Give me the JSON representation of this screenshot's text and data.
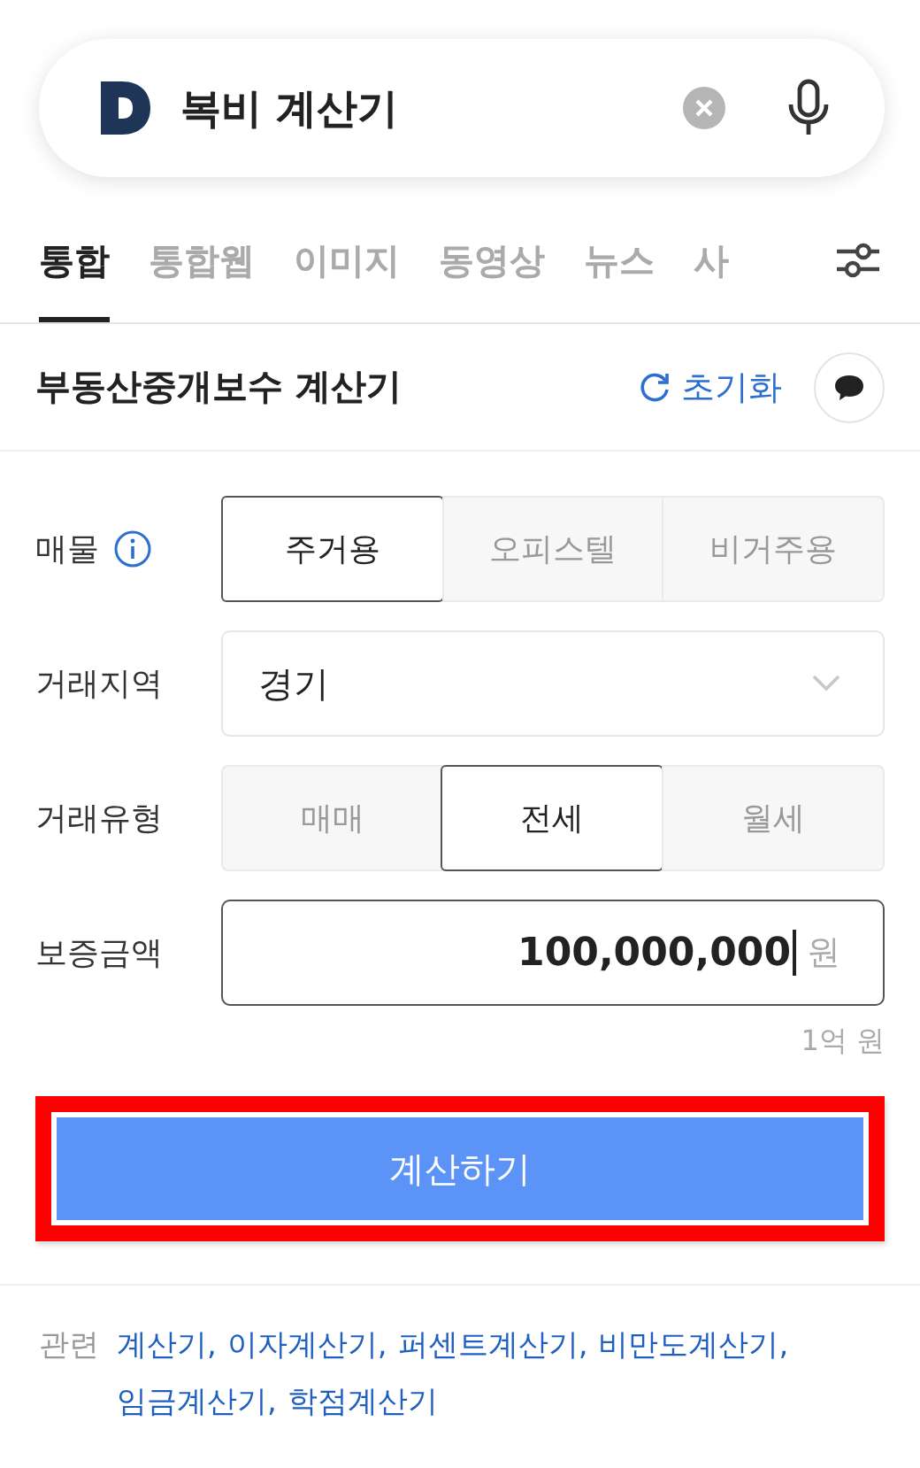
{
  "search": {
    "value": "복비 계산기"
  },
  "tabs": [
    {
      "label": "통합",
      "selected": true
    },
    {
      "label": "통합웹",
      "selected": false
    },
    {
      "label": "이미지",
      "selected": false
    },
    {
      "label": "동영상",
      "selected": false
    },
    {
      "label": "뉴스",
      "selected": false
    },
    {
      "label": "사",
      "selected": false
    }
  ],
  "calculator": {
    "title": "부동산중개보수 계산기",
    "reset": "초기화",
    "fields": [
      {
        "kind": "segments",
        "label": "매물",
        "info": true,
        "options": [
          {
            "label": "주거용",
            "selected": true
          },
          {
            "label": "오피스텔",
            "selected": false
          },
          {
            "label": "비거주용",
            "selected": false
          }
        ]
      },
      {
        "kind": "select",
        "label": "거래지역",
        "value": "경기"
      },
      {
        "kind": "segments",
        "label": "거래유형",
        "info": false,
        "options": [
          {
            "label": "매매",
            "selected": false
          },
          {
            "label": "전세",
            "selected": true
          },
          {
            "label": "월세",
            "selected": false
          }
        ]
      },
      {
        "kind": "amount",
        "label": "보증금액",
        "value": "100,000,000",
        "unit": "원",
        "hint": "1억 원"
      }
    ],
    "button": {
      "label": "계산하기",
      "highlighted": true
    }
  },
  "related": {
    "label": "관련",
    "links": [
      "계산기,",
      "이자계산기,",
      "퍼센트계산기,",
      "비만도계산기,",
      "임금계산기,",
      "학점계산기"
    ]
  }
}
